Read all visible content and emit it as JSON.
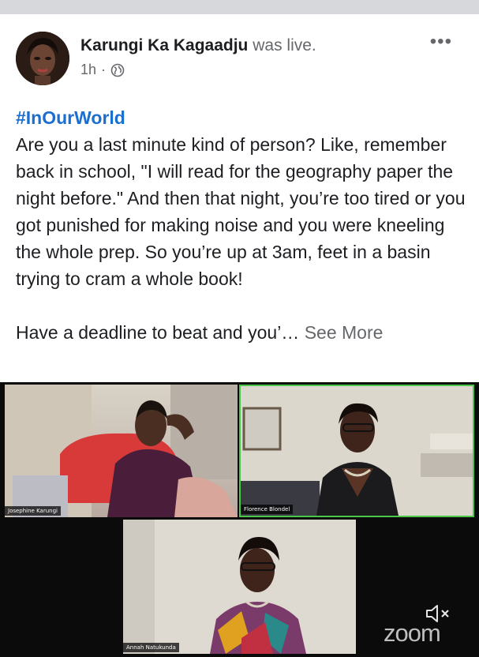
{
  "post": {
    "author_name": "Karungi Ka Kagaadju",
    "author_verb": "was live.",
    "time": "1h",
    "separator": "·",
    "privacy_icon": "globe-icon",
    "more_icon": "more-options-icon",
    "more_glyph": "•••",
    "hashtag": "#InOurWorld",
    "paragraph_1": "Are you a last minute kind of person? Like, remember back in school, \"I will read for the geography paper the night before.\" And then that night, you’re too tired or you got punished for making noise and you were kneeling the whole prep. So you’re up at 3am, feet in a basin trying to cram a whole book!",
    "paragraph_2": "Have a deadline to beat and you’… ",
    "see_more": "See More"
  },
  "video": {
    "participants": [
      {
        "name": "Josephine Karungi",
        "active": false
      },
      {
        "name": "Florence Blondel",
        "active": true
      },
      {
        "name": "Annah Natukunda",
        "active": false
      }
    ],
    "mute_icon": "speaker-muted-icon",
    "brand": "zoom"
  },
  "colors": {
    "hashtag": "#1a6fd1",
    "secondary_text": "#65676b",
    "active_speaker_border": "#4bc84b",
    "video_background": "#0b0b0b"
  }
}
